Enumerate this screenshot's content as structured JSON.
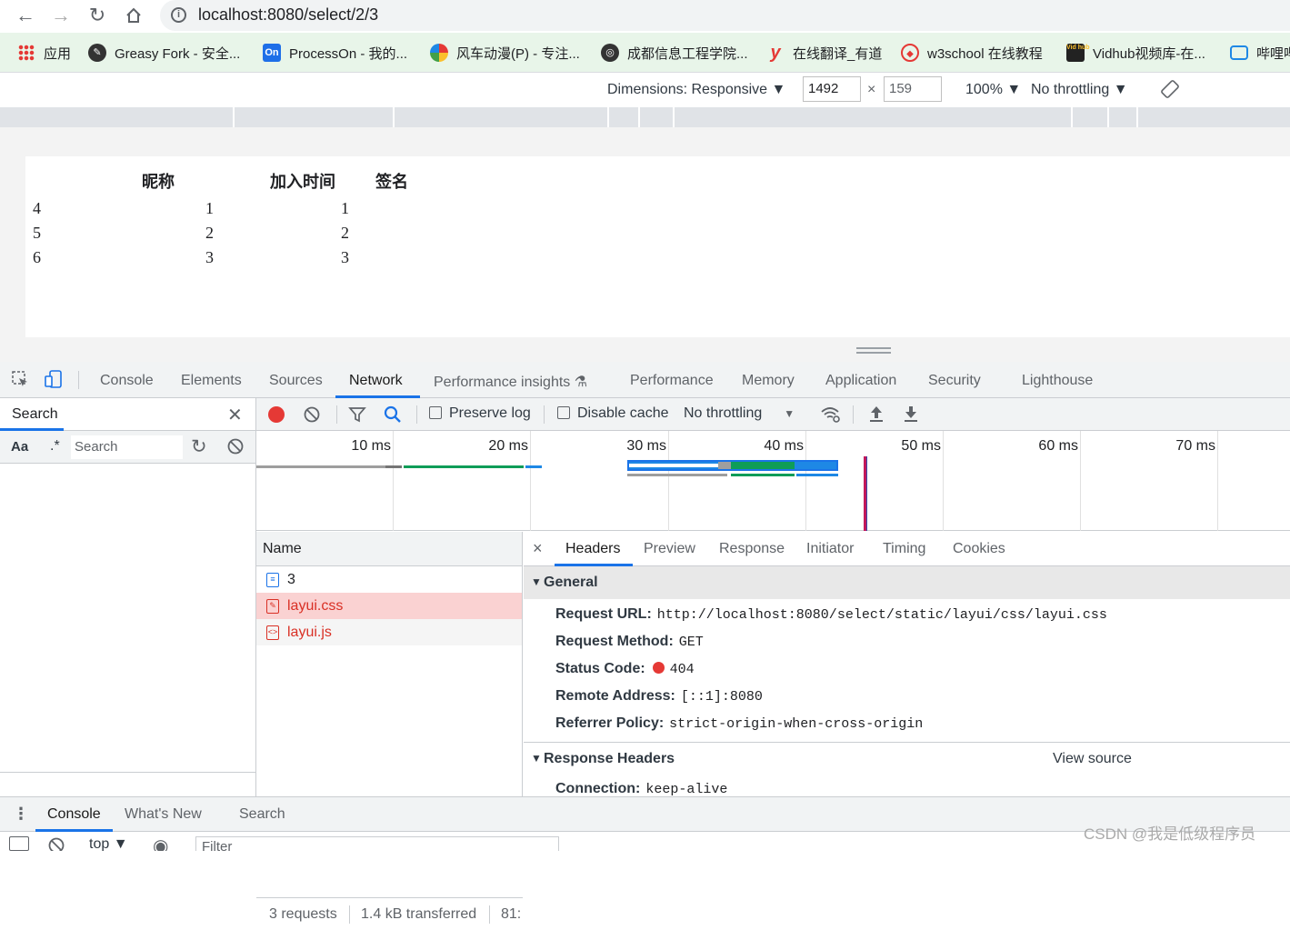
{
  "browser": {
    "url": "localhost:8080/select/2/3",
    "bookmarks": [
      {
        "label": "应用",
        "icon": "apps-grid-icon"
      },
      {
        "label": "Greasy Fork - 安全...",
        "icon": "greasyfork-icon"
      },
      {
        "label": "ProcessOn - 我的...",
        "icon": "processon-icon"
      },
      {
        "label": "风车动漫(P) - 专注...",
        "icon": "pinwheel-icon"
      },
      {
        "label": "成都信息工程学院...",
        "icon": "globe-icon"
      },
      {
        "label": "在线翻译_有道",
        "icon": "youdao-icon"
      },
      {
        "label": "w3school 在线教程",
        "icon": "w3school-icon"
      },
      {
        "label": "Vidhub视频库-在...",
        "icon": "vidhub-icon"
      },
      {
        "label": "哔哩哔",
        "icon": "bilibili-icon"
      }
    ],
    "processon_badge": "On",
    "vidhub_badge": "Vid hub",
    "youdao_glyph": "y"
  },
  "device_toolbar": {
    "dimensions_label": "Dimensions: Responsive",
    "width": "1492",
    "height": "159",
    "times": "×",
    "zoom": "100%",
    "throttling": "No throttling"
  },
  "page": {
    "table": {
      "headers": [
        "",
        "昵称",
        "加入时间",
        "签名"
      ],
      "rows": [
        [
          "4",
          "",
          "1",
          "1"
        ],
        [
          "5",
          "",
          "2",
          "2"
        ],
        [
          "6",
          "",
          "3",
          "3"
        ]
      ]
    }
  },
  "devtools": {
    "tabs": [
      "Console",
      "Elements",
      "Sources",
      "Network",
      "Performance insights",
      "Performance",
      "Memory",
      "Application",
      "Security",
      "Lighthouse"
    ],
    "active_tab": "Network",
    "search": {
      "title": "Search",
      "aa": "Aa",
      "regex": ".*",
      "placeholder": "Search"
    },
    "network_toolbar": {
      "preserve_log": "Preserve log",
      "disable_cache": "Disable cache",
      "throttling": "No throttling"
    },
    "timeline": {
      "ticks": [
        "10 ms",
        "20 ms",
        "30 ms",
        "40 ms",
        "50 ms",
        "60 ms",
        "70 ms"
      ]
    },
    "requests": {
      "name_header": "Name",
      "items": [
        {
          "name": "3",
          "status": "ok"
        },
        {
          "name": "layui.css",
          "status": "error"
        },
        {
          "name": "layui.js",
          "status": "error"
        }
      ]
    },
    "summary": {
      "requests": "3 requests",
      "transferred": "1.4 kB transferred",
      "extra": "81:"
    },
    "detail": {
      "tabs": [
        "Headers",
        "Preview",
        "Response",
        "Initiator",
        "Timing",
        "Cookies"
      ],
      "close": "×",
      "general_title": "General",
      "general": [
        {
          "key": "Request URL:",
          "value": "http://localhost:8080/select/static/layui/css/layui.css"
        },
        {
          "key": "Request Method:",
          "value": "GET"
        },
        {
          "key": "Status Code:",
          "value": "404"
        },
        {
          "key": "Remote Address:",
          "value": "[::1]:8080"
        },
        {
          "key": "Referrer Policy:",
          "value": "strict-origin-when-cross-origin"
        }
      ],
      "response_headers_title": "Response Headers",
      "view_source": "View source",
      "response_headers": [
        {
          "key": "Connection:",
          "value": "keep-alive"
        }
      ]
    },
    "drawer": {
      "tabs": [
        "Console",
        "What's New",
        "Search"
      ],
      "context": "top",
      "filter_placeholder": "Filter"
    }
  },
  "watermark": "CSDN @我是低级程序员",
  "colors": {
    "accent": "#1a73e8",
    "error": "#d93025",
    "record": "#e53935",
    "error_row_bg": "#fad2d2",
    "bookmarks_bg": "#e8f5e9"
  }
}
